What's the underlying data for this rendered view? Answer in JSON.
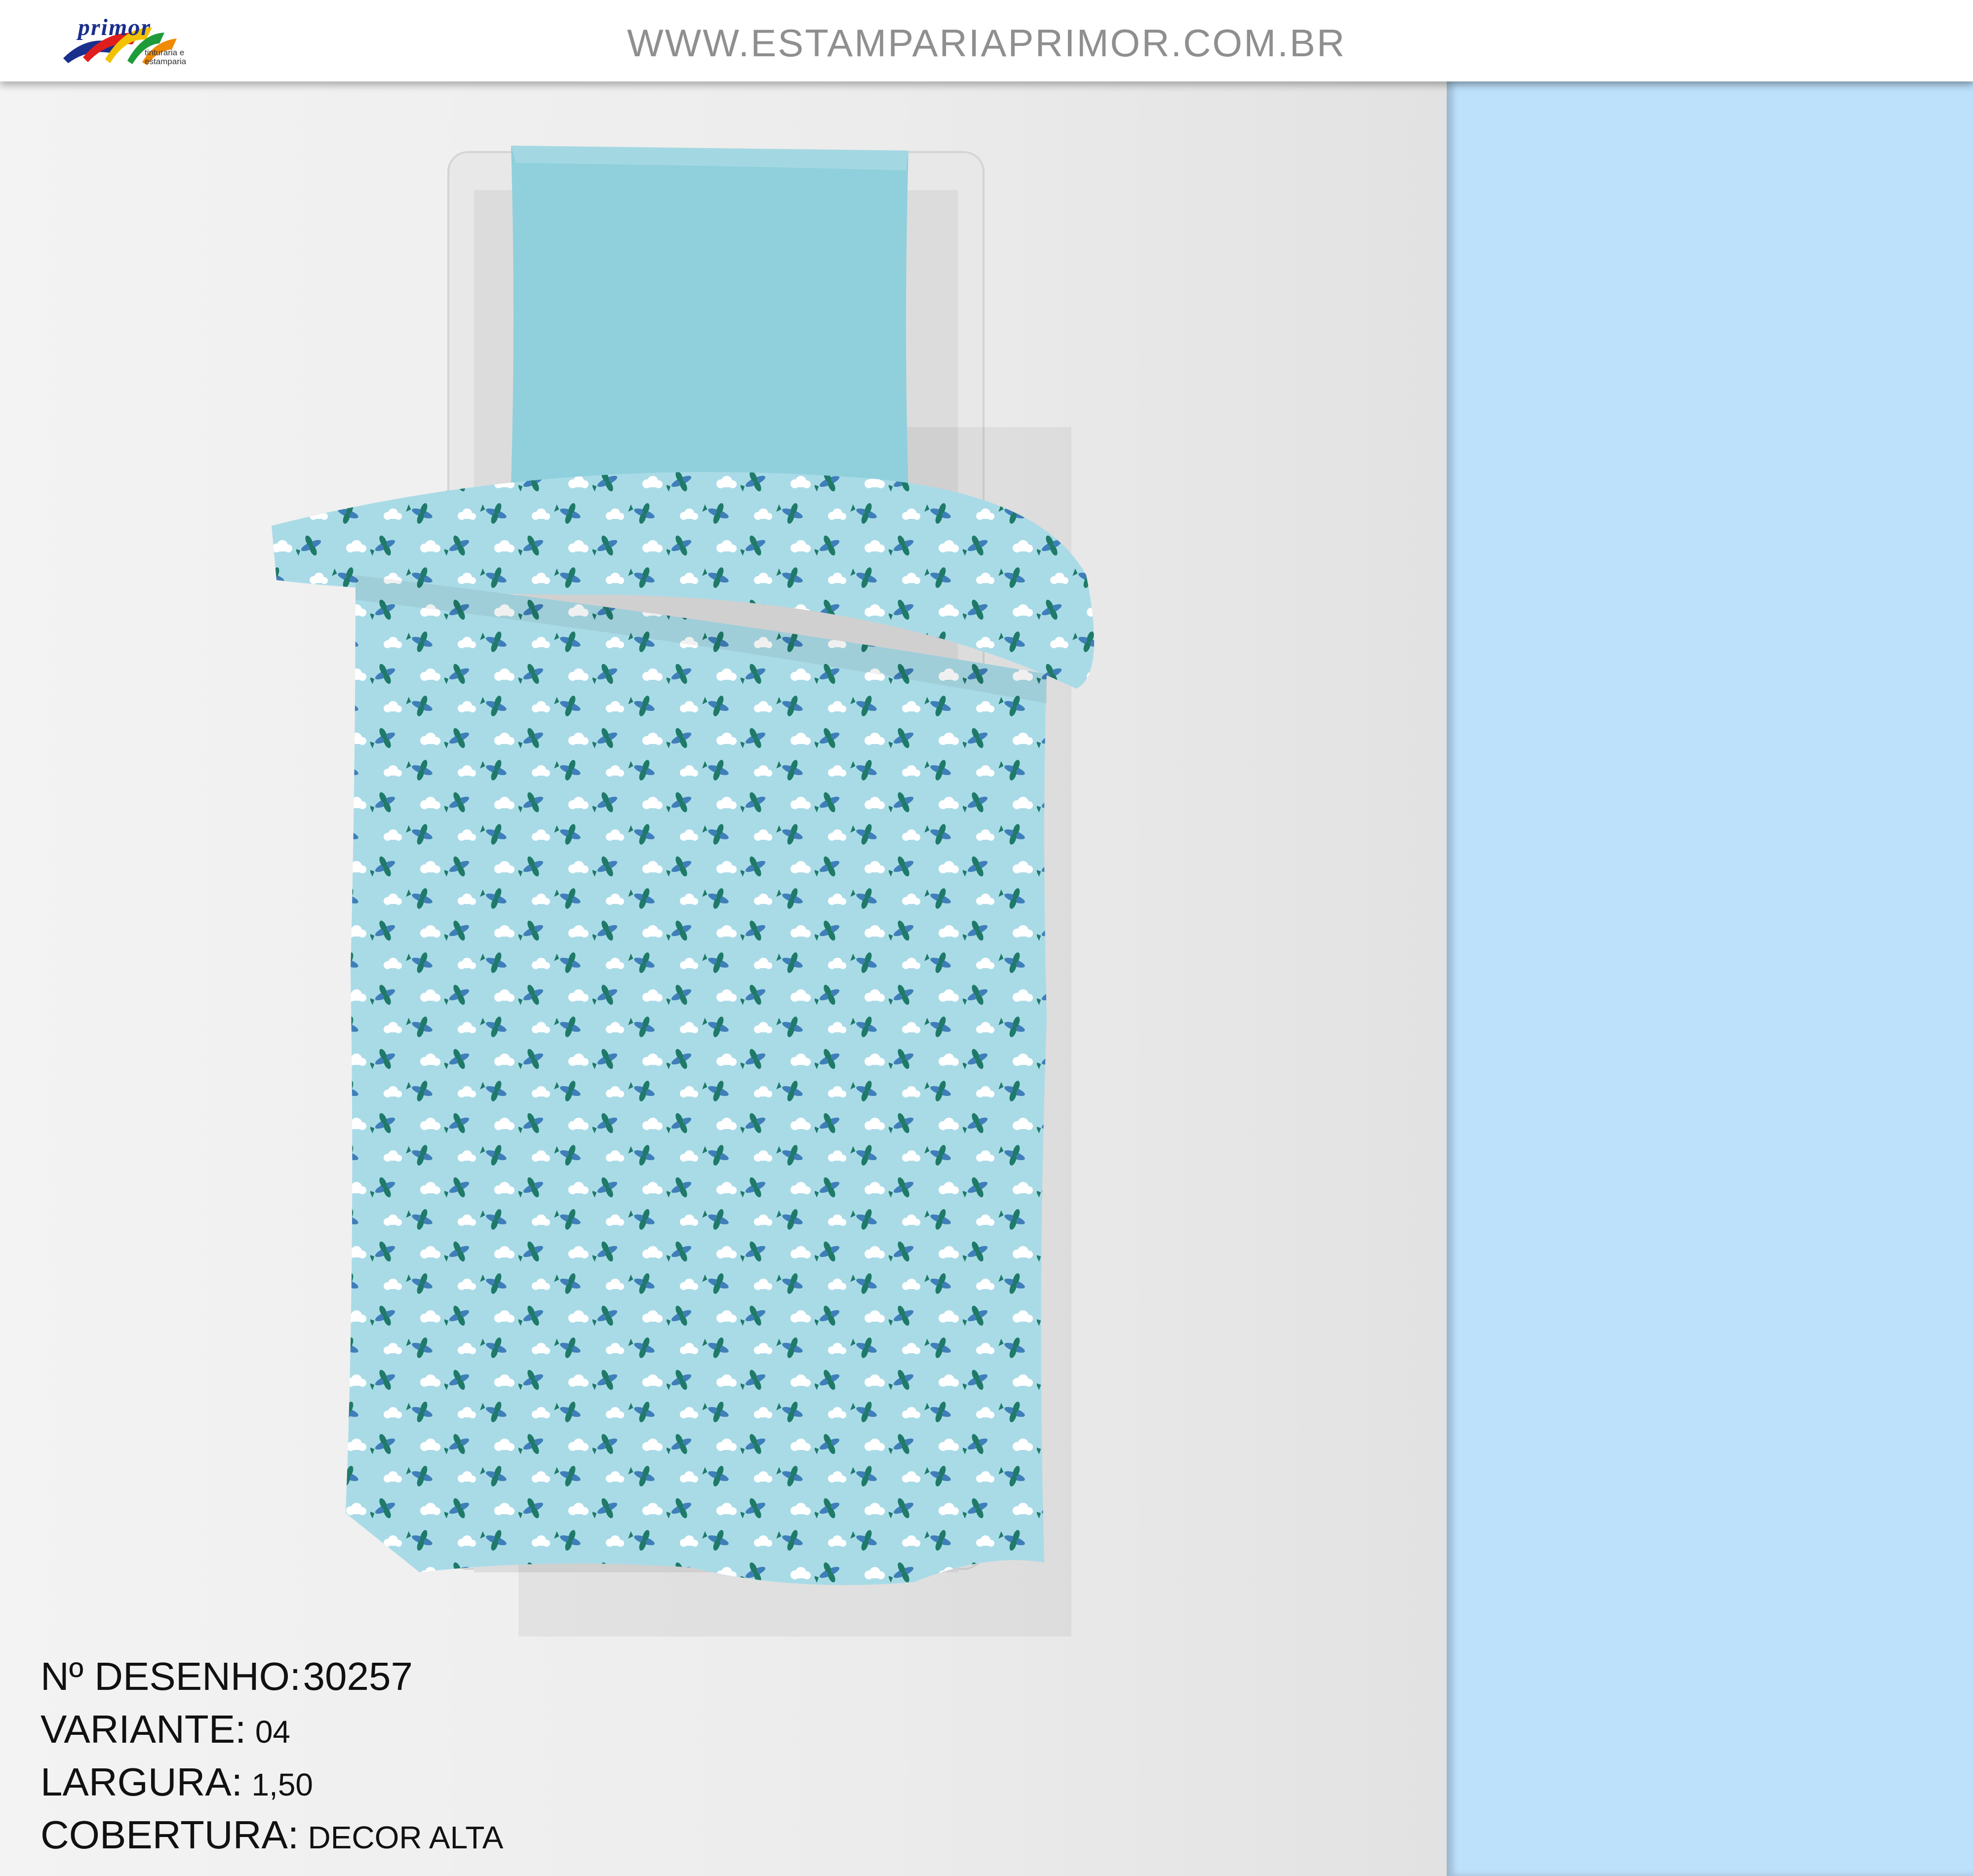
{
  "header": {
    "logo": {
      "wordmark": "primor",
      "tagline_line1": "tinturaria e",
      "tagline_line2": "estamparia",
      "colors": [
        "#1a2f8c",
        "#e11e1e",
        "#f2c200",
        "#1f9b3a",
        "#f08a00"
      ]
    },
    "url": "WWW.ESTAMPARIAPRIMOR.COM.BR"
  },
  "info": {
    "design_number_label": "Nº DESENHO:",
    "design_number_value": "30257",
    "variant_label": "VARIANTE:",
    "variant_value": "04",
    "width_label": "LARGURA:",
    "width_value": "1,50",
    "coverage_label": "COBERTURA:",
    "coverage_value": "DECOR ALTA"
  },
  "pattern": {
    "background": "#bde0fb",
    "plane_body_color": "#4a88c8",
    "plane_wing_color": "#1f7a68",
    "cloud_color": "#ffffff",
    "icons": [
      "airplane-icon",
      "cloud-icon"
    ]
  },
  "mockup": {
    "pillow_color": "#8fd0dc",
    "duvet_color": "#a9dbe7",
    "mattress_color": "#e8e8e8"
  }
}
